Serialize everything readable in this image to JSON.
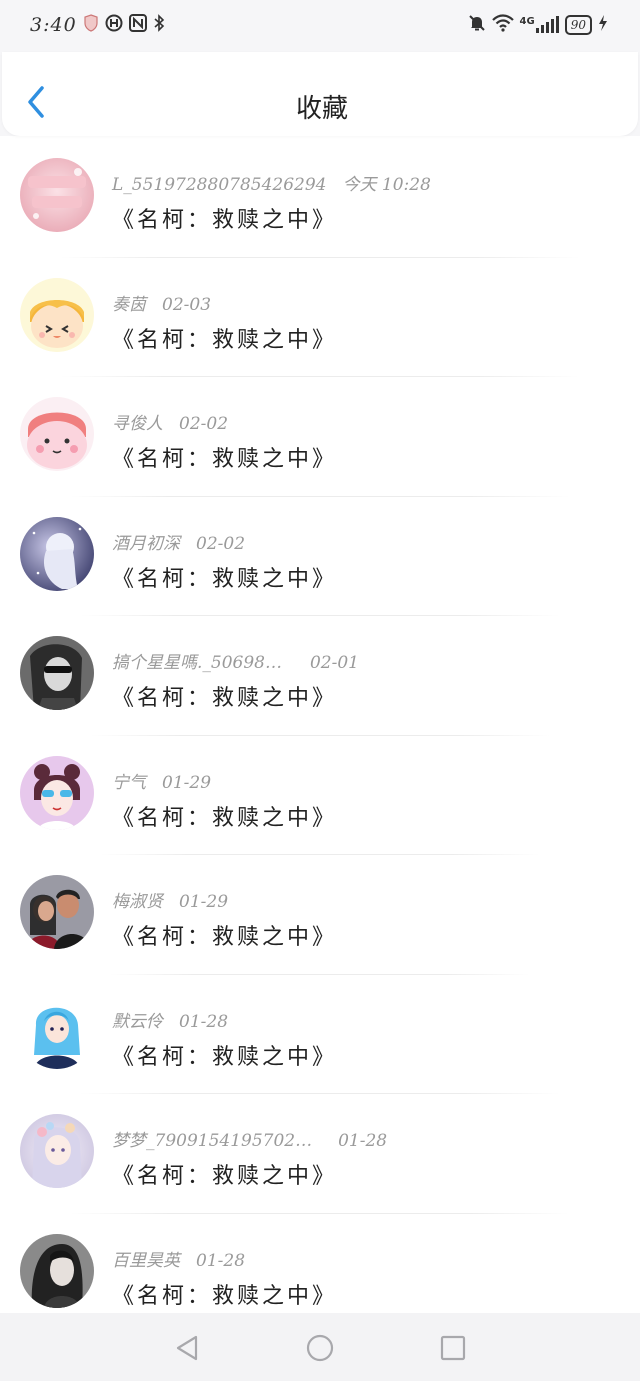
{
  "status_bar": {
    "time": "3:40",
    "battery": "90",
    "network": "4G",
    "left_icons": [
      "shield-icon",
      "nfc-alt-icon",
      "nfc-icon",
      "bluetooth-icon"
    ],
    "right_icons": [
      "mute-bell-icon",
      "wifi-icon",
      "signal-icon",
      "battery-icon",
      "charging-icon"
    ]
  },
  "header": {
    "title": "收藏"
  },
  "list": [
    {
      "name": "L_5519728807854262​94",
      "date": "今天 10:28",
      "title": "《名柯：救赎之中》"
    },
    {
      "name": "奏茵",
      "date": "02-03",
      "title": "《名柯：救赎之中》"
    },
    {
      "name": "寻俊人",
      "date": "02-02",
      "title": "《名柯：救赎之中》"
    },
    {
      "name": "酒月初深",
      "date": "02-02",
      "title": "《名柯：救赎之中》"
    },
    {
      "name": "搞个星星嗎._50698…",
      "date": "02-01",
      "title": "《名柯：救赎之中》"
    },
    {
      "name": "宁气",
      "date": "01-29",
      "title": "《名柯：救赎之中》"
    },
    {
      "name": "梅淑贤",
      "date": "01-29",
      "title": "《名柯：救赎之中》"
    },
    {
      "name": "默云伶",
      "date": "01-28",
      "title": "《名柯：救赎之中》"
    },
    {
      "name": "梦梦_7909154195702…",
      "date": "01-28",
      "title": "《名柯：救赎之中》"
    },
    {
      "name": "百里昊英",
      "date": "01-28",
      "title": "《名柯：救赎之中》"
    }
  ],
  "colors": {
    "accent": "#2f8fe0",
    "meta_text": "#9a9a9a",
    "title_text": "#222222",
    "background": "#ffffff",
    "bars": "#f3f3f5"
  },
  "nav": {
    "back": "back-triangle-icon",
    "home": "home-circle-icon",
    "recents": "recents-square-icon"
  }
}
